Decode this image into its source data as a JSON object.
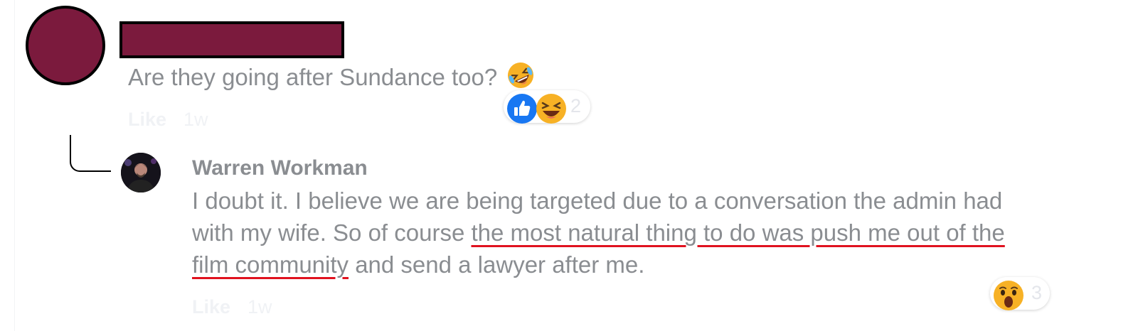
{
  "comment1": {
    "text": "Are they going after Sundance too?",
    "inline_emoji": "rolling-on-floor-laughing",
    "like_label": "Like",
    "time": "1w",
    "reactions": {
      "types": [
        "like",
        "haha"
      ],
      "count": "2"
    }
  },
  "reply": {
    "author": "Warren Workman",
    "text_parts": [
      "I doubt it. I believe we are being targeted due to a conversation the admin had with my wife. So of course ",
      "the most natural thing to do was push me out of the film community",
      " and send a lawyer after me."
    ],
    "like_label": "Like",
    "time": "1w",
    "reactions": {
      "types": [
        "wow"
      ],
      "count": "3"
    }
  },
  "colors": {
    "redaction": "#7b1a3d",
    "text": "#8a8d91",
    "underline": "#e0121f",
    "like_blue": "#1877f2",
    "emoji_yellow": "#f7b125"
  }
}
